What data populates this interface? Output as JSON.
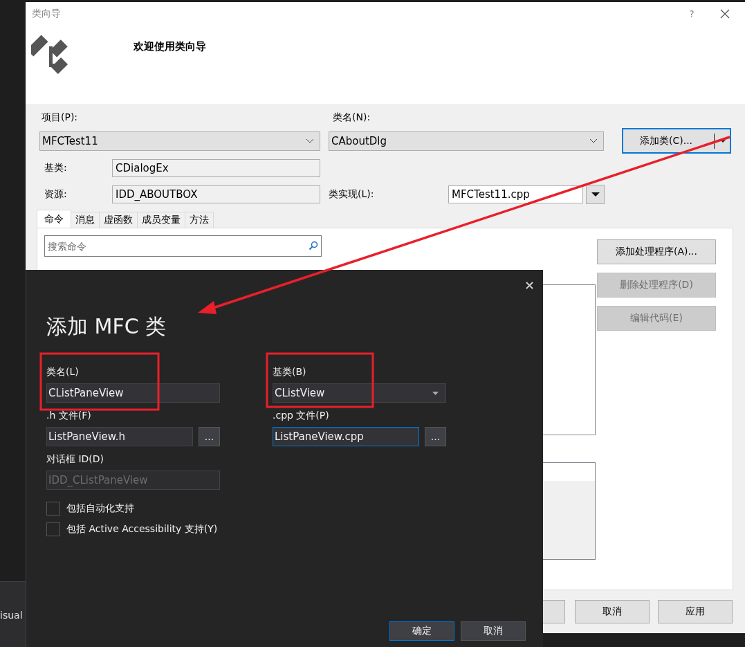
{
  "class_wizard": {
    "title": "类向导",
    "help": "?",
    "heading": "欢迎使用类向导",
    "project": {
      "label": "项目(P):",
      "value": "MFCTest11"
    },
    "class_name": {
      "label": "类名(N):",
      "value": "CAboutDlg"
    },
    "add_class_button": "添加类(C)...",
    "base_class": {
      "label": "基类:",
      "value": "CDialogEx"
    },
    "resource": {
      "label": "资源:",
      "value": "IDD_ABOUTBOX"
    },
    "class_impl": {
      "label": "类实现(L):",
      "value": "MFCTest11.cpp"
    },
    "tabs": [
      {
        "label": "命令",
        "selected": true
      },
      {
        "label": "消息",
        "selected": false
      },
      {
        "label": "虚函数",
        "selected": false
      },
      {
        "label": "成员变量",
        "selected": false
      },
      {
        "label": "方法",
        "selected": false
      }
    ],
    "search": {
      "placeholder": "搜索命令"
    },
    "actions": [
      {
        "label": "添加处理程序(A)...",
        "disabled": false
      },
      {
        "label": "删除处理程序(D)",
        "disabled": true
      },
      {
        "label": "编辑代码(E)",
        "disabled": true
      }
    ],
    "footer_buttons": [
      "取消",
      "应用"
    ]
  },
  "add_mfc_class": {
    "title": "添加 MFC 类",
    "fields": [
      {
        "kind": "text",
        "label": "类名(L)",
        "value": "CListPaneView",
        "focused": false,
        "disabled": false
      },
      {
        "kind": "dropdown",
        "label": "基类(B)",
        "value": "CListView",
        "focused": false,
        "disabled": false
      },
      {
        "kind": "file",
        "label": ".h 文件(F)",
        "value": "ListPaneView.h",
        "browse": "...",
        "focused": false,
        "disabled": false
      },
      {
        "kind": "file",
        "label": ".cpp 文件(P)",
        "value": "ListPaneView.cpp",
        "browse": "...",
        "focused": true,
        "disabled": false
      },
      {
        "kind": "text",
        "label": "对话框 ID(D)",
        "value": "IDD_CListPaneView",
        "focused": false,
        "disabled": true
      }
    ],
    "checkboxes": [
      {
        "label": "包括自动化支持",
        "checked": false
      },
      {
        "label": "包括 Active Accessibility 支持(Y)",
        "checked": false
      }
    ],
    "buttons": [
      {
        "label": "确定",
        "default": true
      },
      {
        "label": "取消",
        "default": false
      }
    ]
  },
  "ide": {
    "fragments": [
      "isual"
    ]
  }
}
